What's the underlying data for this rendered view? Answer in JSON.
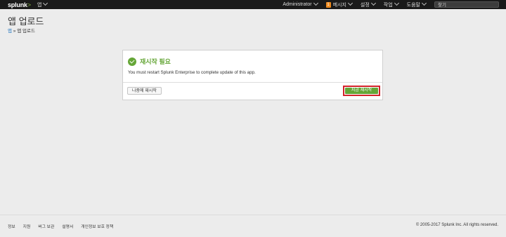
{
  "topbar": {
    "logo": "splunk",
    "logo_suffix": ">",
    "apps_menu": "앱",
    "user_menu": "Administrator",
    "messages_count": "1",
    "messages_label": "메시지",
    "settings_label": "설정",
    "activity_label": "작업",
    "help_label": "도움말",
    "search_placeholder": "찾기"
  },
  "page": {
    "title": "앱 업로드",
    "breadcrumb_root": "앱",
    "breadcrumb_sep": " » ",
    "breadcrumb_current": "앱 업로드"
  },
  "modal": {
    "title": "재시작 필요",
    "message": "You must restart Splunk Enterprise to complete update of this app.",
    "later_button": "나중에 재시작",
    "restart_button": "지금 재시작"
  },
  "footer": {
    "links": [
      "정보",
      "지원",
      "버그 보관",
      "설명서",
      "개인정보 보호 정책"
    ],
    "copyright": "© 2005-2017 Splunk Inc. All rights reserved."
  },
  "colors": {
    "accent_green": "#65a637",
    "highlight_red": "#d4222a",
    "topbar_bg": "#1a1a1a"
  }
}
